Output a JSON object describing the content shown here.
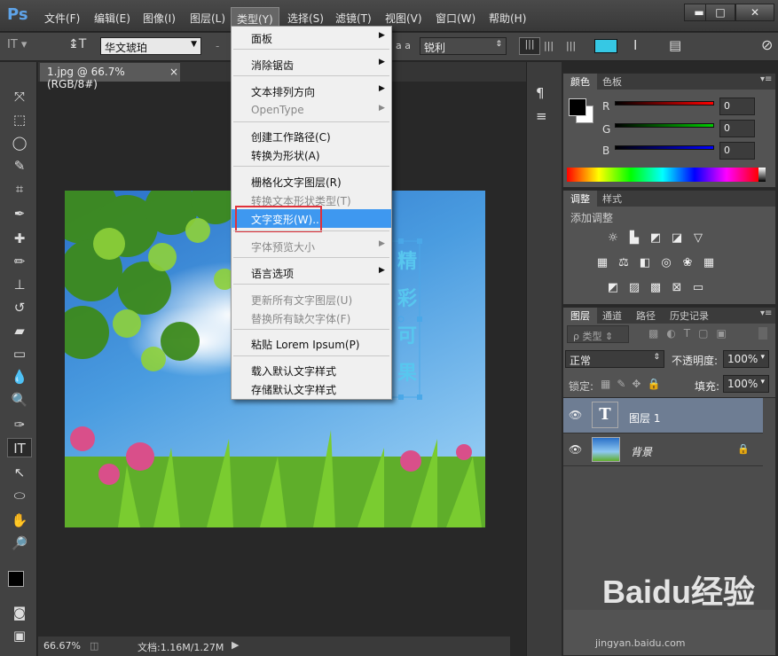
{
  "app": {
    "logo": "Ps"
  },
  "menubar": {
    "items": [
      "文件(F)",
      "编辑(E)",
      "图像(I)",
      "图层(L)",
      "类型(Y)",
      "选择(S)",
      "滤镜(T)",
      "视图(V)",
      "窗口(W)",
      "帮助(H)"
    ]
  },
  "window_controls": {
    "minimize": "▬",
    "maximize": "□",
    "close": "✕"
  },
  "options": {
    "font_family": "华文琥珀",
    "font_size_value": "-",
    "aa_label": "a a",
    "antialias": "锐利"
  },
  "document": {
    "tab_title": "1.jpg @ 66.7%(RGB/8#)",
    "tab_close": "×",
    "zoom": "66.67%",
    "doc_info": "文档:1.16M/1.27M",
    "text_chars": [
      "精",
      "彩",
      "可",
      "果"
    ]
  },
  "dropdown": {
    "items": [
      {
        "label": "面板",
        "disabled": false,
        "submenu": true
      },
      {
        "label": "消除锯齿",
        "disabled": false,
        "submenu": true
      },
      {
        "label": "文本排列方向",
        "disabled": false,
        "submenu": true
      },
      {
        "label": "OpenType",
        "disabled": true,
        "submenu": true
      },
      {
        "label": "创建工作路径(C)",
        "disabled": false,
        "submenu": false
      },
      {
        "label": "转换为形状(A)",
        "disabled": false,
        "submenu": false
      },
      {
        "label": "栅格化文字图层(R)",
        "disabled": false,
        "submenu": false
      },
      {
        "label": "转换文本形状类型(T)",
        "disabled": true,
        "submenu": false
      },
      {
        "label": "文字变形(W)...",
        "disabled": false,
        "submenu": false,
        "highlighted": true
      },
      {
        "label": "字体预览大小",
        "disabled": true,
        "submenu": true
      },
      {
        "label": "语言选项",
        "disabled": false,
        "submenu": true
      },
      {
        "label": "更新所有文字图层(U)",
        "disabled": true,
        "submenu": false
      },
      {
        "label": "替换所有缺欠字体(F)",
        "disabled": true,
        "submenu": false
      },
      {
        "label": "粘贴 Lorem Ipsum(P)",
        "disabled": false,
        "submenu": false
      },
      {
        "label": "载入默认文字样式",
        "disabled": false,
        "submenu": false
      },
      {
        "label": "存储默认文字样式",
        "disabled": false,
        "submenu": false
      }
    ]
  },
  "color_panel": {
    "tabs": [
      "颜色",
      "色板"
    ],
    "channels": [
      {
        "label": "R",
        "value": "0"
      },
      {
        "label": "G",
        "value": "0"
      },
      {
        "label": "B",
        "value": "0"
      }
    ]
  },
  "adjust_panel": {
    "tabs": [
      "调整",
      "样式"
    ],
    "heading": "添加调整"
  },
  "layers_panel": {
    "tabs": [
      "图层",
      "通道",
      "路径",
      "历史记录"
    ],
    "filter_label": "ρ 类型",
    "blend_mode": "正常",
    "opacity_label": "不透明度:",
    "opacity": "100%",
    "lock_label": "锁定:",
    "fill_label": "填充:",
    "fill": "100%",
    "layers": [
      {
        "name": "图层 1",
        "type": "text",
        "thumb": "T"
      },
      {
        "name": "背景",
        "type": "image",
        "locked": true
      }
    ]
  },
  "watermark": {
    "text": "Baidu经验",
    "url": "jingyan.baidu.com"
  },
  "colors": {
    "accent": "#3e98f0",
    "highlight_box": "#e0313b",
    "text_frame": "#4aa8e8"
  }
}
